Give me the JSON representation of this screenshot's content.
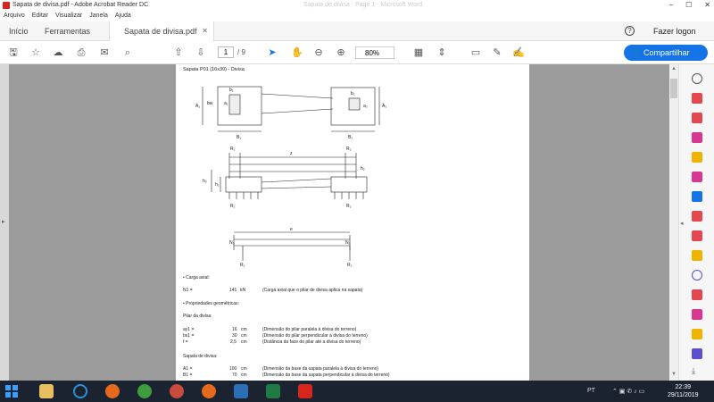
{
  "window": {
    "title": "Sapata de divisa.pdf - Adobe Acrobat Reader DC",
    "ghost_title": "Sapata de divisa - Page 1 - Microsoft Word"
  },
  "menu": [
    "Arquivo",
    "Editar",
    "Visualizar",
    "Janela",
    "Ajuda"
  ],
  "tabs": {
    "home": "Início",
    "tools": "Ferramentas",
    "doc": "Sapata de divisa.pdf"
  },
  "header": {
    "login": "Fazer logon"
  },
  "toolbar": {
    "page_current": "1",
    "page_total": "/ 9",
    "zoom": "80%",
    "share_label": "Compartilhar"
  },
  "doc": {
    "heading": "Sapata P01 (16x30) - Divisa",
    "labels": {
      "A1": "A₁",
      "bw": "bw",
      "a1": "a₁",
      "b1": "b₁",
      "B1": "B₁",
      "a2": "a₂",
      "b2": "b₂",
      "B2": "B₂",
      "A2": "A₂",
      "R1": "R₁",
      "R2": "R₂",
      "z": "z",
      "h1": "h₁",
      "h2": "h₂",
      "ho": "hₒ",
      "N1": "N₁",
      "N2": "N₂",
      "e": "e"
    },
    "sections": {
      "axial": "• Carga axial:",
      "geometry": "• Propriedades geométricas:",
      "pilar": "Pilar da divisa:",
      "sapata": "Sapata de divisa:"
    },
    "rows_axial": [
      {
        "name": "N1 =",
        "value": "141",
        "unit": "kN",
        "desc": "(Carga axial que o pilar de divisa aplica na sapata)"
      }
    ],
    "rows_pilar": [
      {
        "name": "ay1 =",
        "value": "16",
        "unit": "cm",
        "desc": "(Dimensão do pilar paralela à divisa do terreno)"
      },
      {
        "name": "bx1 =",
        "value": "30",
        "unit": "cm",
        "desc": "(Dimensão do pilar perpendicular à divisa do terreno)"
      },
      {
        "name": "f =",
        "value": "2,5",
        "unit": "cm",
        "desc": "(Distância da face do pilar até a divisa do terreno)"
      }
    ],
    "rows_sapata": [
      {
        "name": "A1 =",
        "value": "100",
        "unit": "cm",
        "desc": "(Dimensão da base da sapata paralela à divisa do terreno)"
      },
      {
        "name": "B1 =",
        "value": "70",
        "unit": "cm",
        "desc": "(Dimensão da base da sapata perpendicular à divisa do terreno)"
      }
    ]
  },
  "taskbar": {
    "lang": "PT",
    "time": "22:39",
    "date": "29/11/2019"
  }
}
